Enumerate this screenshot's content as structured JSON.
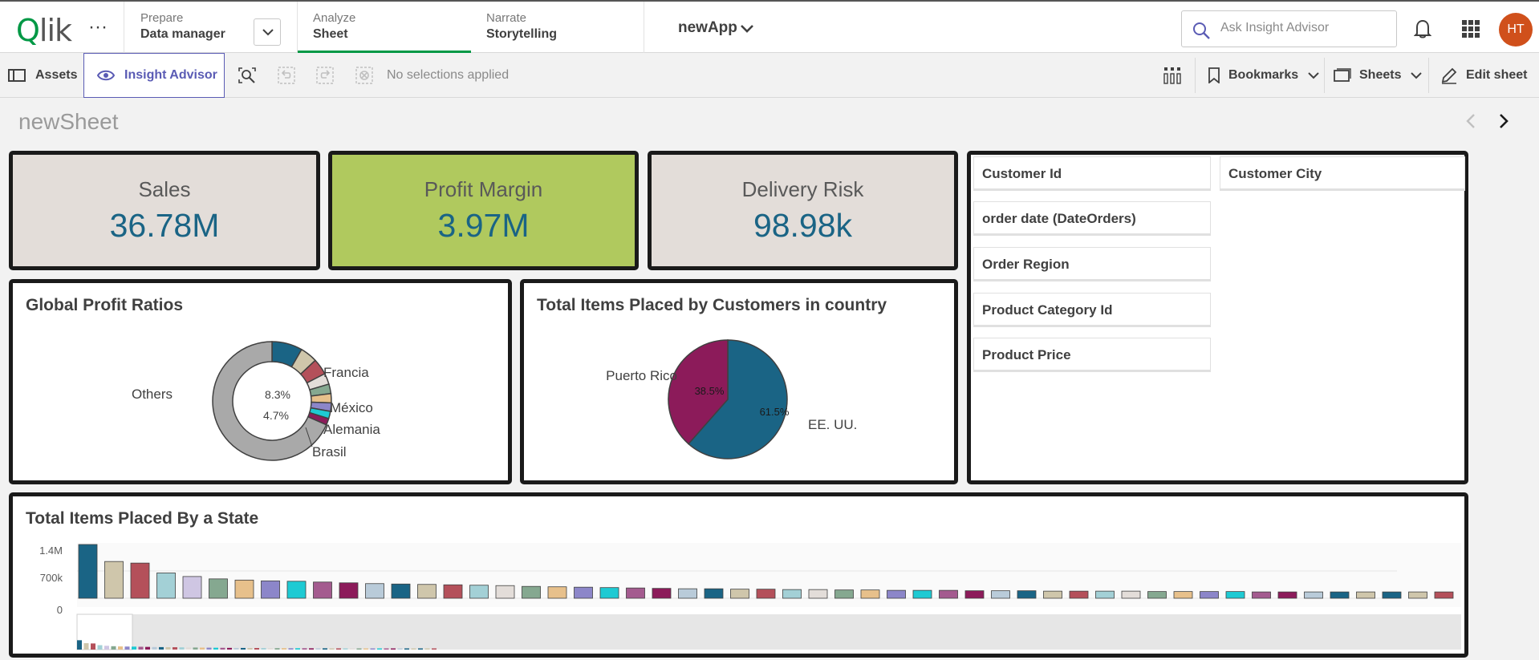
{
  "nav": {
    "logo": "Qlik",
    "prepare": {
      "small": "Prepare",
      "big": "Data manager"
    },
    "analyze": {
      "small": "Analyze",
      "big": "Sheet"
    },
    "narrate": {
      "small": "Narrate",
      "big": "Storytelling"
    },
    "app_name": "newApp",
    "search_placeholder": "Ask Insight Advisor",
    "avatar_initials": "HT",
    "accent": "#009845"
  },
  "toolbar": {
    "assets": "Assets",
    "insight_advisor": "Insight Advisor",
    "no_selections": "No selections applied",
    "bookmarks": "Bookmarks",
    "sheets": "Sheets",
    "edit_sheet": "Edit sheet"
  },
  "sheet": {
    "title": "newSheet"
  },
  "kpis": [
    {
      "label": "Sales",
      "value": "36.78M",
      "bg": "#e3ddd9"
    },
    {
      "label": "Profit Margin",
      "value": "3.97M",
      "bg": "#b0c95e"
    },
    {
      "label": "Delivery Risk",
      "value": "98.98k",
      "bg": "#e3ddd9"
    }
  ],
  "filters": {
    "col1": [
      "Customer Id",
      "order date (DateOrders)",
      "Order Region",
      "Product Category Id",
      "Product Price"
    ],
    "col2": [
      "Customer City"
    ]
  },
  "charts": {
    "profit_ratios": {
      "title": "Global Profit Ratios"
    },
    "items_by_country": {
      "title": "Total Items Placed by Customers in country"
    },
    "items_by_state": {
      "title": "Total Items Placed By a State"
    }
  },
  "chart_data": [
    {
      "type": "pie",
      "title": "Global Profit Ratios",
      "variant": "donut",
      "labels": [
        "Others",
        "Francia",
        "México",
        "Alemania",
        "Brasil"
      ],
      "inner_labels": [
        "8.3%",
        "4.7%"
      ],
      "slices": [
        {
          "name": "s1",
          "value": 8.3,
          "color": "#1a6485"
        },
        {
          "name": "s2",
          "value": 4.7,
          "color": "#cfc6ab"
        },
        {
          "name": "s3",
          "value": 4.4,
          "color": "#b4505a"
        },
        {
          "name": "s4",
          "value": 3.0,
          "color": "#e3ddd9"
        },
        {
          "name": "s5",
          "value": 2.6,
          "color": "#85a890"
        },
        {
          "name": "s6",
          "value": 2.5,
          "color": "#e7c08b"
        },
        {
          "name": "s7",
          "value": 2.3,
          "color": "#8c86c9"
        },
        {
          "name": "s8",
          "value": 2.0,
          "color": "#1ecad3"
        },
        {
          "name": "s9",
          "value": 1.8,
          "color": "#8c1b5a"
        },
        {
          "name": "Others",
          "value": 68.4,
          "color": "#a9a9a9"
        }
      ]
    },
    {
      "type": "pie",
      "title": "Total Items Placed by Customers in country",
      "slices": [
        {
          "name": "EE. UU.",
          "value": 61.5,
          "label": "61.5%",
          "color": "#1a6485"
        },
        {
          "name": "Puerto Rico",
          "value": 38.5,
          "label": "38.5%",
          "color": "#8c1b5a"
        }
      ]
    },
    {
      "type": "bar",
      "title": "Total Items Placed By a State",
      "yticks": [
        "1.4M",
        "700k",
        "0"
      ],
      "ylim": [
        0,
        1400000
      ],
      "values": [
        1360000,
        930000,
        890000,
        640000,
        550000,
        490000,
        460000,
        440000,
        430000,
        410000,
        390000,
        370000,
        360000,
        350000,
        340000,
        330000,
        320000,
        300000,
        290000,
        280000,
        270000,
        260000,
        250000,
        240000,
        240000,
        230000,
        230000,
        220000,
        220000,
        210000,
        210000,
        200000,
        200000,
        200000,
        190000,
        190000,
        190000,
        180000,
        180000,
        180000,
        180000,
        170000,
        170000,
        170000,
        170000,
        160000,
        160000,
        160000,
        160000,
        160000,
        160000,
        160000,
        160000
      ],
      "colors": [
        "#1a6485",
        "#cfc6ab",
        "#b4505a",
        "#a3d0d6",
        "#cfc6e3",
        "#85a890",
        "#e7c08b",
        "#8c86c9",
        "#1ecad3",
        "#a45b8f",
        "#8c1b5a",
        "#b9cbd9",
        "#1a6485",
        "#cfc6ab",
        "#b4505a",
        "#a3d0d6",
        "#e3ddd9",
        "#85a890",
        "#e7c08b",
        "#8c86c9",
        "#1ecad3",
        "#a45b8f",
        "#8c1b5a",
        "#b9cbd9",
        "#1a6485",
        "#cfc6ab",
        "#b4505a",
        "#a3d0d6",
        "#e3ddd9",
        "#85a890",
        "#e7c08b",
        "#8c86c9",
        "#1ecad3",
        "#a45b8f",
        "#8c1b5a",
        "#b9cbd9",
        "#1a6485",
        "#cfc6ab",
        "#b4505a",
        "#a3d0d6",
        "#e3ddd9",
        "#85a890",
        "#e7c08b",
        "#8c86c9",
        "#1ecad3",
        "#a45b8f",
        "#8c1b5a",
        "#b9cbd9",
        "#1a6485",
        "#cfc6ab"
      ]
    }
  ]
}
